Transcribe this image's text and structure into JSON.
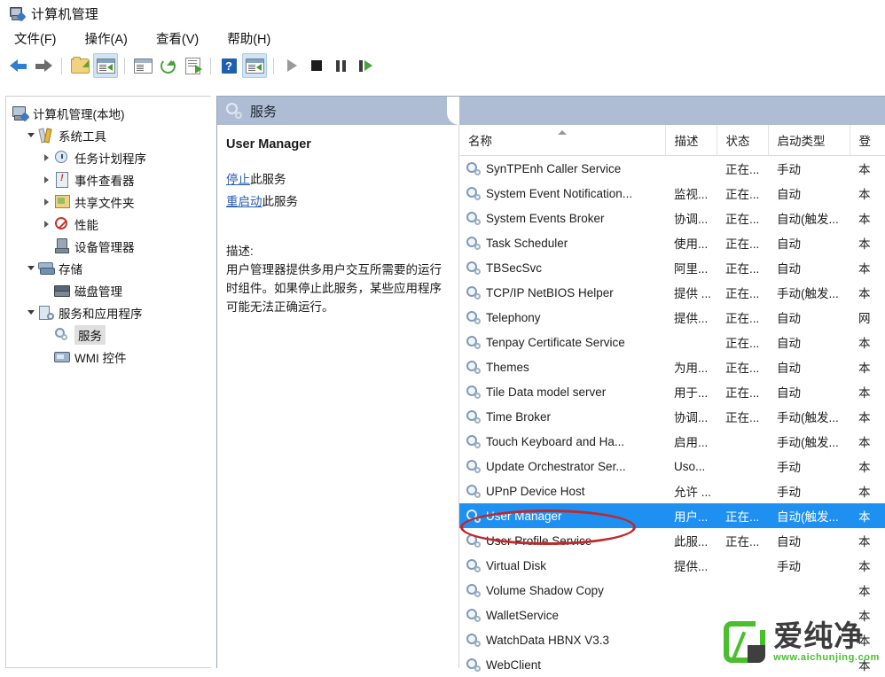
{
  "window": {
    "title": "计算机管理",
    "icon": "computer-management-icon"
  },
  "menu": [
    {
      "label": "文件(F)",
      "name": "menu-file"
    },
    {
      "label": "操作(A)",
      "name": "menu-action"
    },
    {
      "label": "查看(V)",
      "name": "menu-view"
    },
    {
      "label": "帮助(H)",
      "name": "menu-help"
    }
  ],
  "toolbar": {
    "back": "back-arrow-icon",
    "forward": "forward-arrow-icon",
    "up_folder": "up-folder-icon",
    "show_hide_tree": "show-hide-console-tree-icon",
    "properties": "properties-icon",
    "refresh": "refresh-icon",
    "export_list": "export-list-icon",
    "help": "help-icon",
    "show_action_pane": "show-action-pane-icon",
    "start": "start-service-icon",
    "stop": "stop-service-icon",
    "pause": "pause-service-icon",
    "restart": "restart-service-icon"
  },
  "tree": {
    "root": {
      "label": "计算机管理(本地)",
      "icon": "computer-icon"
    },
    "items": [
      {
        "label": "系统工具",
        "icon": "tools-icon",
        "chevron": "open",
        "indent": 1
      },
      {
        "label": "任务计划程序",
        "icon": "clock-icon",
        "chevron": "closed",
        "indent": 2
      },
      {
        "label": "事件查看器",
        "icon": "event-viewer-icon",
        "chevron": "closed",
        "indent": 2
      },
      {
        "label": "共享文件夹",
        "icon": "shared-folder-icon",
        "chevron": "closed",
        "indent": 2
      },
      {
        "label": "性能",
        "icon": "performance-icon",
        "chevron": "closed",
        "indent": 2
      },
      {
        "label": "设备管理器",
        "icon": "device-manager-icon",
        "chevron": "none",
        "indent": 2
      },
      {
        "label": "存储",
        "icon": "storage-icon",
        "chevron": "open",
        "indent": 1
      },
      {
        "label": "磁盘管理",
        "icon": "disk-management-icon",
        "chevron": "none",
        "indent": 2
      },
      {
        "label": "服务和应用程序",
        "icon": "services-and-applications-icon",
        "chevron": "open",
        "indent": 1
      },
      {
        "label": "服务",
        "icon": "services-icon",
        "chevron": "none",
        "indent": 2,
        "selected": true
      },
      {
        "label": "WMI 控件",
        "icon": "wmi-control-icon",
        "chevron": "none",
        "indent": 2
      }
    ]
  },
  "pane": {
    "header_title": "服务",
    "header_icon": "services-icon"
  },
  "detail": {
    "service_name": "User Manager",
    "stop_link": "停止",
    "stop_suffix": "此服务",
    "restart_link": "重启动",
    "restart_suffix": "此服务",
    "description_label": "描述:",
    "description": "用户管理器提供多用户交互所需要的运行时组件。如果停止此服务，某些应用程序可能无法正确运行。"
  },
  "list": {
    "columns": [
      {
        "label": "名称",
        "name": "column-name",
        "sorted": true
      },
      {
        "label": "描述",
        "name": "column-description"
      },
      {
        "label": "状态",
        "name": "column-status"
      },
      {
        "label": "启动类型",
        "name": "column-startup-type"
      },
      {
        "label": "登",
        "name": "column-log-on-as"
      }
    ],
    "rows": [
      {
        "name": "SynTPEnh Caller Service",
        "desc": "",
        "status": "正在...",
        "startup": "手动",
        "logon": "本"
      },
      {
        "name": "System Event Notification...",
        "desc": "监视...",
        "status": "正在...",
        "startup": "自动",
        "logon": "本"
      },
      {
        "name": "System Events Broker",
        "desc": "协调...",
        "status": "正在...",
        "startup": "自动(触发...",
        "logon": "本"
      },
      {
        "name": "Task Scheduler",
        "desc": "使用...",
        "status": "正在...",
        "startup": "自动",
        "logon": "本"
      },
      {
        "name": "TBSecSvc",
        "desc": "阿里...",
        "status": "正在...",
        "startup": "自动",
        "logon": "本"
      },
      {
        "name": "TCP/IP NetBIOS Helper",
        "desc": "提供 ...",
        "status": "正在...",
        "startup": "手动(触发...",
        "logon": "本"
      },
      {
        "name": "Telephony",
        "desc": "提供...",
        "status": "正在...",
        "startup": "自动",
        "logon": "网"
      },
      {
        "name": "Tenpay Certificate Service",
        "desc": "",
        "status": "正在...",
        "startup": "自动",
        "logon": "本"
      },
      {
        "name": "Themes",
        "desc": "为用...",
        "status": "正在...",
        "startup": "自动",
        "logon": "本"
      },
      {
        "name": "Tile Data model server",
        "desc": "用于...",
        "status": "正在...",
        "startup": "自动",
        "logon": "本"
      },
      {
        "name": "Time Broker",
        "desc": "协调...",
        "status": "正在...",
        "startup": "手动(触发...",
        "logon": "本"
      },
      {
        "name": "Touch Keyboard and Ha...",
        "desc": "启用...",
        "status": "",
        "startup": "手动(触发...",
        "logon": "本"
      },
      {
        "name": "Update Orchestrator Ser...",
        "desc": "Uso...",
        "status": "",
        "startup": "手动",
        "logon": "本"
      },
      {
        "name": "UPnP Device Host",
        "desc": "允许 ...",
        "status": "",
        "startup": "手动",
        "logon": "本"
      },
      {
        "name": "User Manager",
        "desc": "用户...",
        "status": "正在...",
        "startup": "自动(触发...",
        "logon": "本",
        "selected": true
      },
      {
        "name": "User Profile Service",
        "desc": "此服...",
        "status": "正在...",
        "startup": "自动",
        "logon": "本"
      },
      {
        "name": "Virtual Disk",
        "desc": "提供...",
        "status": "",
        "startup": "手动",
        "logon": "本"
      },
      {
        "name": "Volume Shadow Copy",
        "desc": "",
        "status": "",
        "startup": "",
        "logon": "本"
      },
      {
        "name": "WalletService",
        "desc": "",
        "status": "",
        "startup": "",
        "logon": "本"
      },
      {
        "name": "WatchData HBNX V3.3",
        "desc": "",
        "status": "",
        "startup": "",
        "logon": "本"
      },
      {
        "name": "WebClient",
        "desc": "",
        "status": "",
        "startup": "",
        "logon": "本"
      }
    ]
  },
  "watermark": {
    "brand": "爱纯净",
    "url": "www.aichunjing.com",
    "color": "#49bf2e"
  },
  "annotation": {
    "shape": "ellipse",
    "color": "#c0282a",
    "targets": "User Manager"
  }
}
